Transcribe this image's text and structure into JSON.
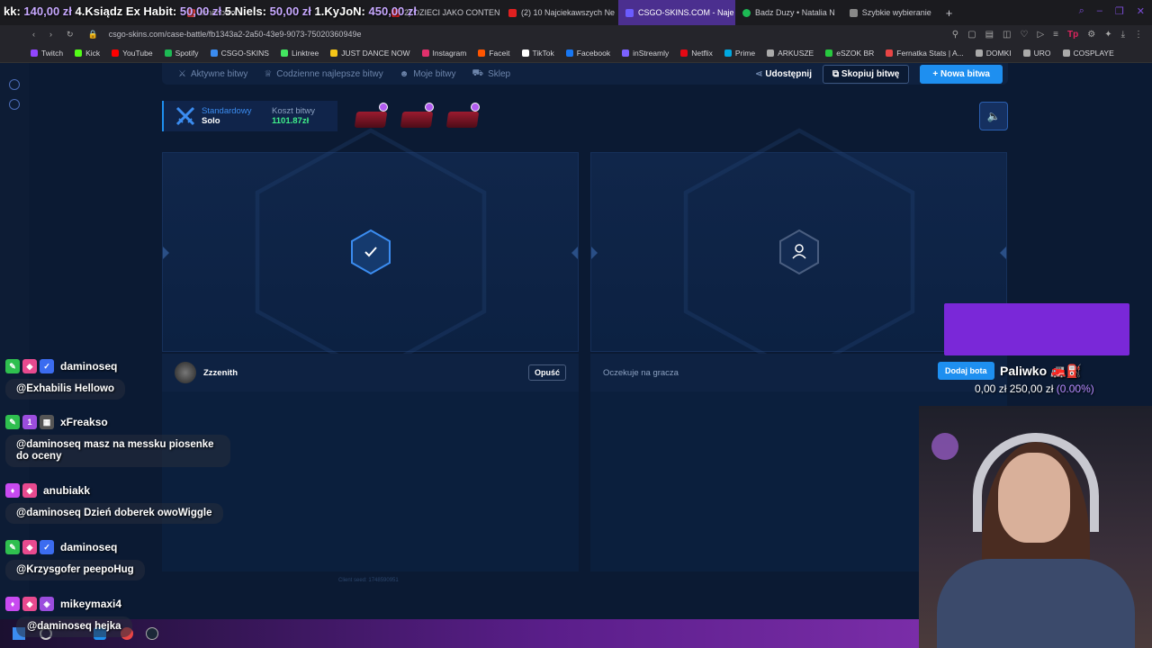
{
  "ticker": {
    "prefix": "kk:",
    "segments": [
      "140,00 zł",
      "4.Ksiądz Ex Habit:",
      "50,00 zł",
      "5.Niels:",
      "50,00 zł",
      "1.KyJoN:",
      "450,00 zł"
    ]
  },
  "tabs": [
    {
      "label": "ernanowo...",
      "color": "#e84545"
    },
    {
      "label": "2) DZIECI JAKO CONTEN",
      "color": "#e02020"
    },
    {
      "label": "(2) 10 Najciekawszych Ne",
      "color": "#e02020"
    },
    {
      "label": "CSGO-SKINS.COM - Naje",
      "color": "#6b5cff"
    },
    {
      "label": "Badz Duzy • Natalia N",
      "color": "#1db954"
    },
    {
      "label": "Szybkie wybieranie",
      "color": "#888888"
    }
  ],
  "address": {
    "url": "csgo-skins.com/case-battle/fb1343a2-2a50-43e9-9073-75020360949e"
  },
  "bookmarks": [
    {
      "label": "Twitch",
      "color": "#9146ff"
    },
    {
      "label": "Kick",
      "color": "#53fc18"
    },
    {
      "label": "YouTube",
      "color": "#ff0000"
    },
    {
      "label": "Spotify",
      "color": "#1db954"
    },
    {
      "label": "CSGO-SKINS",
      "color": "#3b8cf0"
    },
    {
      "label": "Linktree",
      "color": "#43e660"
    },
    {
      "label": "JUST DANCE NOW",
      "color": "#f5c518"
    },
    {
      "label": "Instagram",
      "color": "#e1306c"
    },
    {
      "label": "Faceit",
      "color": "#ff5500"
    },
    {
      "label": "TikTok",
      "color": "#ffffff"
    },
    {
      "label": "Facebook",
      "color": "#1877f2"
    },
    {
      "label": "inStreamly",
      "color": "#7b61ff"
    },
    {
      "label": "Netflix",
      "color": "#e50914"
    },
    {
      "label": "Prime",
      "color": "#00a8e1"
    },
    {
      "label": "ARKUSZE",
      "color": "#aaaaaa"
    },
    {
      "label": "eSZOK BR",
      "color": "#27c93f"
    },
    {
      "label": "Fernatka Stats | A...",
      "color": "#e84545"
    },
    {
      "label": "DOMKI",
      "color": "#aaaaaa"
    },
    {
      "label": "URO",
      "color": "#aaaaaa"
    },
    {
      "label": "COSPLAYE",
      "color": "#aaaaaa"
    }
  ],
  "site_nav": {
    "links": [
      "Aktywne bitwy",
      "Codzienne najlepsze bitwy",
      "Moje bitwy",
      "Sklep"
    ],
    "share_label": "Udostępnij",
    "copy_label": "Skopiuj bitwę",
    "new_label": "+ Nowa bitwa"
  },
  "battle": {
    "mode_label": "Standardowy",
    "mode_value": "Solo",
    "cost_label": "Koszt bitwy",
    "cost_value": "1101.87zł",
    "case_count": 3
  },
  "players": {
    "left_name": "Zzzenith",
    "leave_label": "Opuść",
    "waiting_label": "Oczekuje na gracza",
    "add_bot_label": "Dodaj bota"
  },
  "seed_text": "Client seed: 1748590951",
  "overlay": {
    "fuel_title": "Paliwko 🚒⛽",
    "fuel_current": "0,00 zł",
    "fuel_goal": "250,00 zł",
    "fuel_percent": "(0.00%)"
  },
  "chat": [
    {
      "user": "daminoseq",
      "text": "@Exhabilis Hellowo",
      "badges": [
        "#2fbf4f",
        "#e84a8f",
        "#3b6cf0"
      ]
    },
    {
      "user": "xFreakso",
      "text": "@daminoseq masz na messku piosenke do oceny",
      "badges": [
        "#2fbf4f",
        "#9b4dde",
        "#555555"
      ]
    },
    {
      "user": "anubiakk",
      "text": "@daminoseq Dzień doberek owoWiggle",
      "badges": [
        "#c84af0",
        "#e84a8f"
      ]
    },
    {
      "user": "daminoseq",
      "text": "@Krzysgofer peepoHug",
      "badges": [
        "#2fbf4f",
        "#e84a8f",
        "#3b6cf0"
      ]
    },
    {
      "user": "mikeymaxi4",
      "text": "@daminoseq hejka",
      "badges": [
        "#c84af0",
        "#e84a8f",
        "#9b4dde"
      ]
    }
  ]
}
